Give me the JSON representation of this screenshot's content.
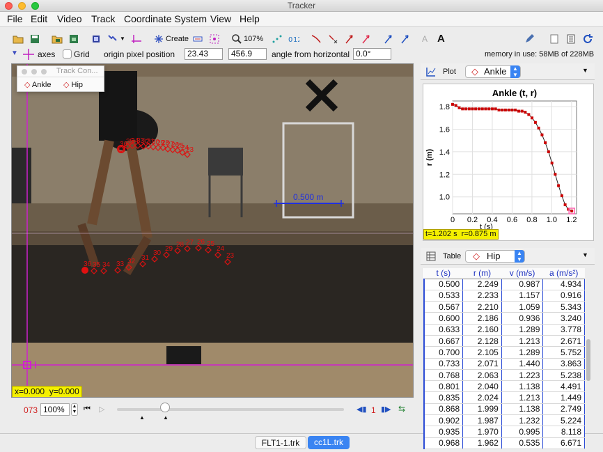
{
  "window": {
    "title": "Tracker"
  },
  "menu": [
    "File",
    "Edit",
    "Video",
    "Track",
    "Coordinate System",
    "View",
    "Help"
  ],
  "toolbar": {
    "create_label": "Create",
    "zoom_label": "107%",
    "memory_label": "memory in use: 58MB of 228MB"
  },
  "axes_bar": {
    "axes_label": "axes",
    "grid_label": "Grid",
    "origin_label": "origin pixel position",
    "origin_x": "23.43",
    "origin_y": "456.9",
    "angle_label": "angle from horizontal",
    "angle_value": "0.0°"
  },
  "track_control": {
    "title": "Track Con...",
    "tracks": [
      "Ankle",
      "Hip"
    ]
  },
  "video": {
    "coord_readout": "x=0.000  y=0.000",
    "tape_label": "0.500 m",
    "hip_labels": [
      "36",
      "35",
      "34",
      "33",
      "32",
      "31",
      "30",
      "29",
      "28",
      "27",
      "26",
      "25",
      "24",
      "23"
    ],
    "ankle_labels": [
      "36",
      "35",
      "34",
      "33",
      "32",
      "31",
      "30",
      "29",
      "28",
      "27",
      "26",
      "25",
      "24",
      "23"
    ]
  },
  "player": {
    "frame": "073",
    "zoom": "100%",
    "step": "1"
  },
  "file_tabs": [
    "FLT1-1.trk",
    "cc1L.trk"
  ],
  "plot_panel": {
    "label": "Plot",
    "track": "Ankle",
    "readout": "t=1.202 s  r=0.875 m"
  },
  "chart_data": {
    "type": "line",
    "title": "Ankle (t, r)",
    "xlabel": "t (s)",
    "ylabel": "r (m)",
    "xlim": [
      0,
      1.25
    ],
    "ylim": [
      0.85,
      1.85
    ],
    "xticks": [
      "0",
      "0.2",
      "0.4",
      "0.6",
      "0.8",
      "1.0",
      "1.2"
    ],
    "yticks": [
      "1.8",
      "1.6",
      "1.4",
      "1.2",
      "1.0"
    ],
    "series": [
      {
        "color": "#cc0000",
        "x": [
          0.0,
          0.033,
          0.067,
          0.1,
          0.133,
          0.167,
          0.2,
          0.233,
          0.267,
          0.3,
          0.333,
          0.367,
          0.4,
          0.433,
          0.467,
          0.5,
          0.533,
          0.567,
          0.6,
          0.633,
          0.667,
          0.7,
          0.733,
          0.768,
          0.801,
          0.835,
          0.868,
          0.902,
          0.935,
          0.968,
          1.002,
          1.035,
          1.068,
          1.102,
          1.135,
          1.168,
          1.202
        ],
        "y": [
          1.82,
          1.81,
          1.79,
          1.78,
          1.78,
          1.78,
          1.78,
          1.78,
          1.78,
          1.78,
          1.78,
          1.78,
          1.78,
          1.78,
          1.77,
          1.77,
          1.77,
          1.77,
          1.77,
          1.77,
          1.76,
          1.76,
          1.75,
          1.73,
          1.7,
          1.66,
          1.61,
          1.55,
          1.48,
          1.4,
          1.3,
          1.2,
          1.1,
          1.01,
          0.93,
          0.89,
          0.875
        ]
      }
    ]
  },
  "table_panel": {
    "label": "Table",
    "track": "Hip",
    "headers": [
      "t (s)",
      "r (m)",
      "v (m/s)",
      "a (m/s²)"
    ],
    "rows": [
      [
        "0.500",
        "2.249",
        "0.987",
        "4.934"
      ],
      [
        "0.533",
        "2.233",
        "1.157",
        "0.916"
      ],
      [
        "0.567",
        "2.210",
        "1.059",
        "5.343"
      ],
      [
        "0.600",
        "2.186",
        "0.936",
        "3.240"
      ],
      [
        "0.633",
        "2.160",
        "1.289",
        "3.778"
      ],
      [
        "0.667",
        "2.128",
        "1.213",
        "2.671"
      ],
      [
        "0.700",
        "2.105",
        "1.289",
        "5.752"
      ],
      [
        "0.733",
        "2.071",
        "1.440",
        "3.863"
      ],
      [
        "0.768",
        "2.063",
        "1.223",
        "5.238"
      ],
      [
        "0.801",
        "2.040",
        "1.138",
        "4.491"
      ],
      [
        "0.835",
        "2.024",
        "1.213",
        "1.449"
      ],
      [
        "0.868",
        "1.999",
        "1.138",
        "2.749"
      ],
      [
        "0.902",
        "1.987",
        "1.232",
        "5.224"
      ],
      [
        "0.935",
        "1.970",
        "0.995",
        "8.118"
      ],
      [
        "0.968",
        "1.962",
        "0.535",
        "6.671"
      ]
    ]
  }
}
